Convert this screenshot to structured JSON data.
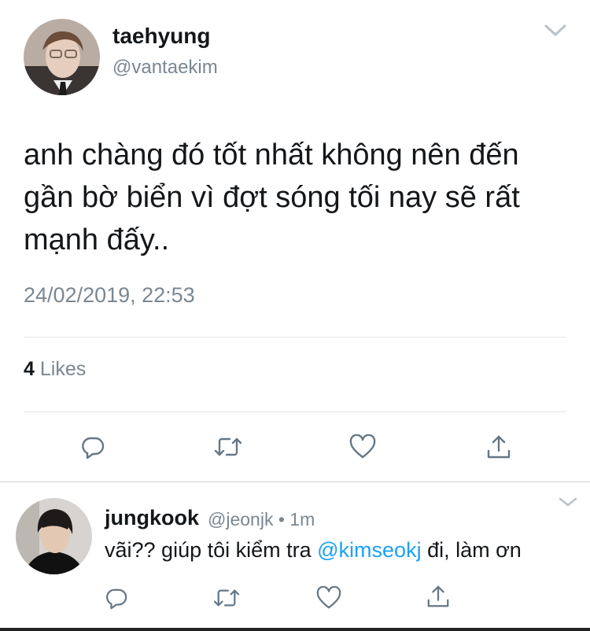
{
  "main_tweet": {
    "display_name": "taehyung",
    "handle": "@vantaekim",
    "text": "anh chàng đó tốt nhất không nên đến gần bờ biển vì đợt sóng tối nay sẽ rất mạnh đấy..",
    "timestamp": "24/02/2019, 22:53",
    "likes_count": "4",
    "likes_label": "Likes"
  },
  "reply": {
    "display_name": "jungkook",
    "handle_time": "@jeonjk • 1m",
    "text_before": "vãi?? giúp tôi kiểm tra ",
    "mention": "@kimseokj",
    "text_after": " đi, làm ơn"
  },
  "actions": [
    "reply-icon",
    "retweet-icon",
    "like-icon",
    "share-icon"
  ],
  "colors": {
    "text": "#14171a",
    "secondary": "#7a8791",
    "link": "#1da1f2",
    "icon": "#657786",
    "divider": "#e1e6ea"
  }
}
